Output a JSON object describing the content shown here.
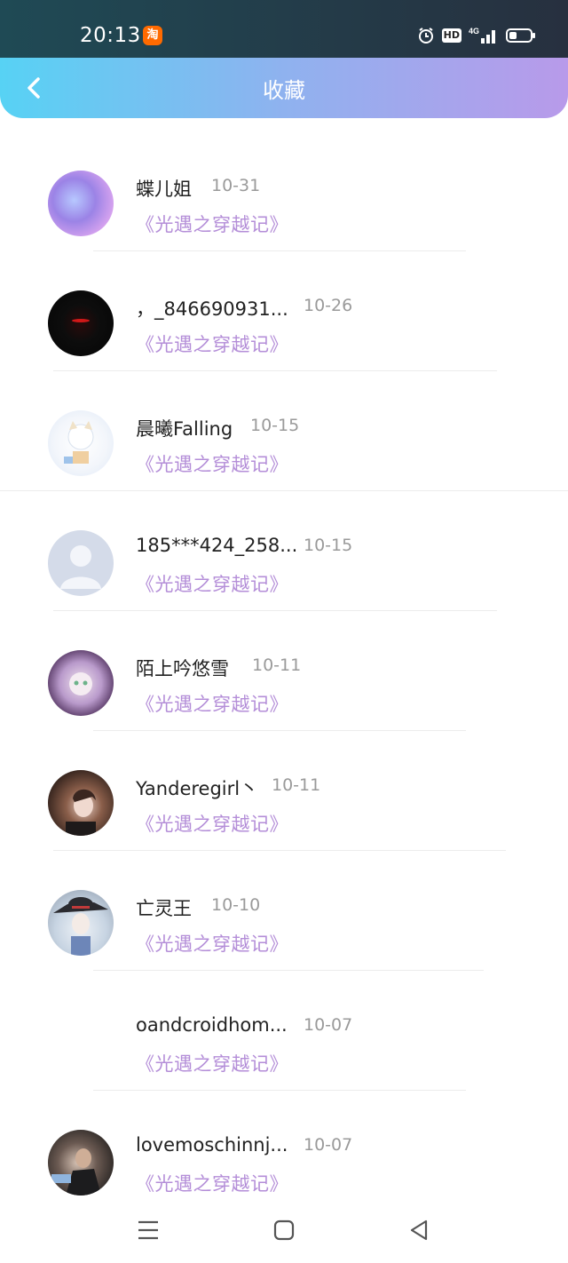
{
  "status_bar": {
    "time": "20:13",
    "app_badge": "淘",
    "hd": "HD",
    "network": "4G",
    "icons": [
      "alarm-icon",
      "hd-icon",
      "signal-icon",
      "battery-icon"
    ]
  },
  "header": {
    "title": "收藏",
    "back_icon": "chevron-left-icon"
  },
  "colors": {
    "header_gradient_start": "#57d2f4",
    "header_gradient_end": "#b89aea",
    "subtitle": "#b48ed8",
    "date": "#9a9a9a"
  },
  "favorites": [
    {
      "name": "蝶儿姐",
      "date": "10-31",
      "subtitle": "《光遇之穿越记》"
    },
    {
      "name": "，_846690931...",
      "date": "10-26",
      "subtitle": "《光遇之穿越记》"
    },
    {
      "name": "晨曦Falling",
      "date": "10-15",
      "subtitle": "《光遇之穿越记》"
    },
    {
      "name": "185***424_258...",
      "date": "10-15",
      "subtitle": "《光遇之穿越记》"
    },
    {
      "name": "陌上吟悠雪",
      "date": "10-11",
      "subtitle": "《光遇之穿越记》"
    },
    {
      "name": "Yanderegirl丶",
      "date": "10-11",
      "subtitle": "《光遇之穿越记》"
    },
    {
      "name": "亡灵王",
      "date": "10-10",
      "subtitle": "《光遇之穿越记》"
    },
    {
      "name": "oandcroidhom...",
      "date": "10-07",
      "subtitle": "《光遇之穿越记》"
    },
    {
      "name": "lovemoschinnj...",
      "date": "10-07",
      "subtitle": "《光遇之穿越记》"
    }
  ],
  "nav_bar": {
    "icons": [
      "menu-icon",
      "home-icon",
      "back-icon"
    ]
  }
}
